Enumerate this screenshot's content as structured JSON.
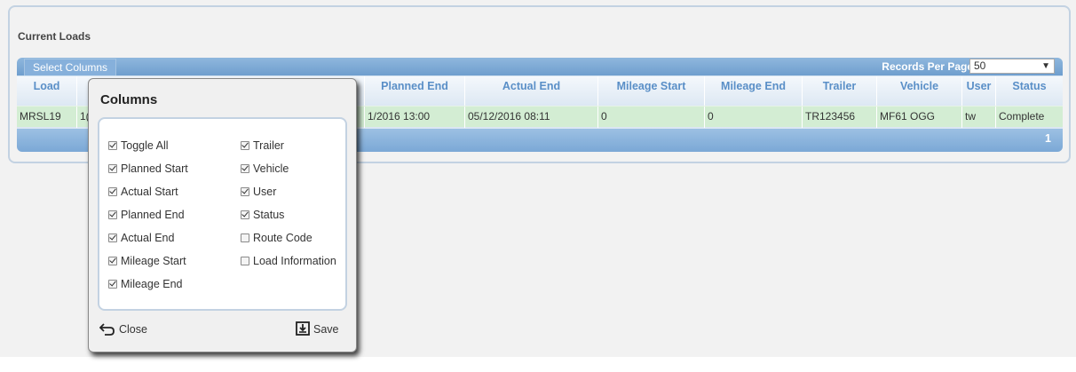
{
  "panel": {
    "title": "Current Loads"
  },
  "toolbar": {
    "select_columns_label": "Select Columns",
    "records_per_page_label": "Records Per Page:",
    "records_per_page_value": "50"
  },
  "table": {
    "headers": [
      "Load",
      "Planned End",
      "Actual End",
      "Mileage Start",
      "Mileage End",
      "Trailer",
      "Vehicle",
      "User",
      "Status"
    ],
    "row": {
      "load": "MRSL19",
      "hidden_start": "1(",
      "planned_end": "1/2016 13:00",
      "actual_end": "05/12/2016 08:11",
      "mileage_start": "0",
      "mileage_end": "0",
      "trailer": "TR123456",
      "vehicle": "MF61 OGG",
      "user": "tw",
      "status": "Complete"
    },
    "page": "1"
  },
  "popup": {
    "title": "Columns",
    "left_column": [
      {
        "label": "Toggle All",
        "checked": true
      },
      {
        "label": "Planned Start",
        "checked": true
      },
      {
        "label": "Actual Start",
        "checked": true
      },
      {
        "label": "Planned End",
        "checked": true
      },
      {
        "label": "Actual End",
        "checked": true
      },
      {
        "label": "Mileage Start",
        "checked": true
      },
      {
        "label": "Mileage End",
        "checked": true
      }
    ],
    "right_column": [
      {
        "label": "Trailer",
        "checked": true
      },
      {
        "label": "Vehicle",
        "checked": true
      },
      {
        "label": "User",
        "checked": true
      },
      {
        "label": "Status",
        "checked": true
      },
      {
        "label": "Route Code",
        "checked": false
      },
      {
        "label": "Load Information",
        "checked": false
      }
    ],
    "close_label": "Close",
    "save_label": "Save"
  },
  "colors": {
    "header_text": "#5a8fc7",
    "row_highlight": "#d3edd3",
    "toolbar": "#7ba8d6"
  }
}
